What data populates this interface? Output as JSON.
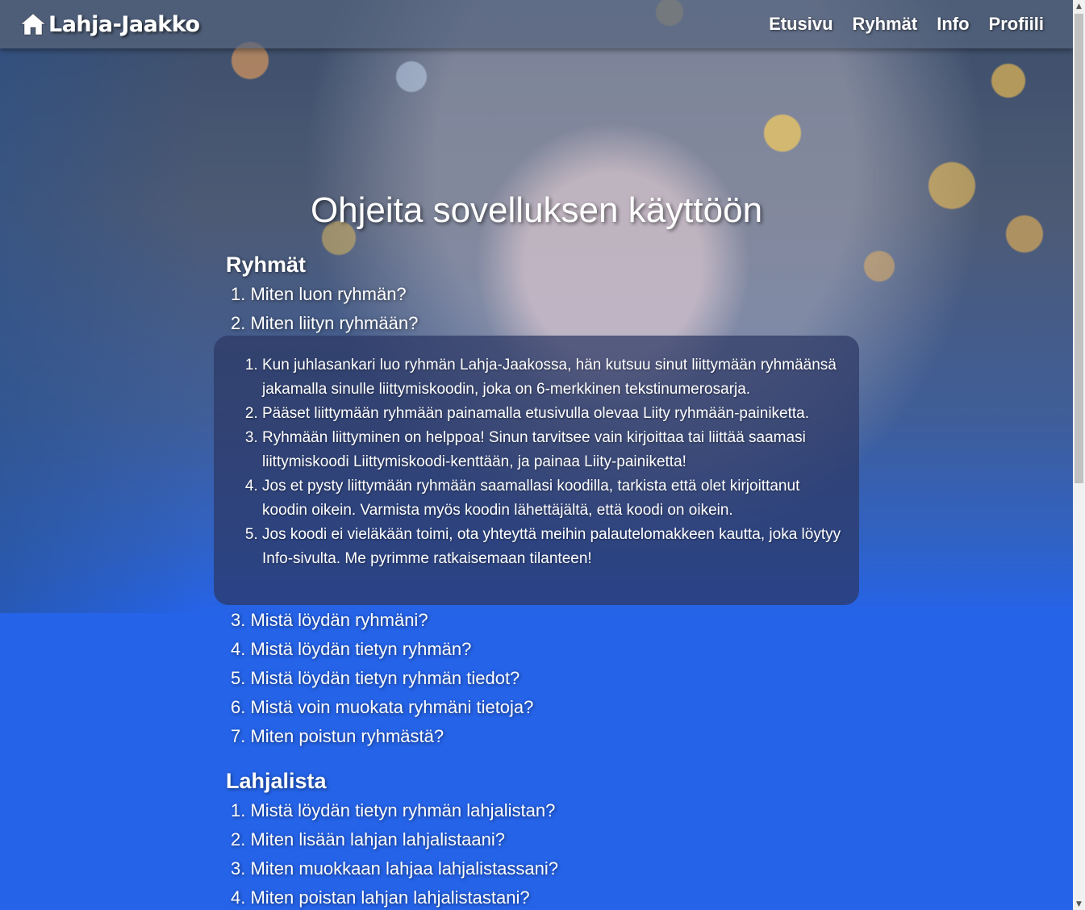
{
  "navbar": {
    "brand": "Lahja-Jaakko",
    "links": [
      "Etusivu",
      "Ryhmät",
      "Info",
      "Profiili"
    ]
  },
  "page_title": "Ohjeita sovelluksen käyttöön",
  "sections": [
    {
      "title": "Ryhmät",
      "questions": [
        "1. Miten luon ryhmän?",
        "2. Miten liityn ryhmään?",
        "3. Mistä löydän ryhmäni?",
        "4. Mistä löydän tietyn ryhmän?",
        "5. Mistä löydän tietyn ryhmän tiedot?",
        "6. Mistä voin muokata ryhmäni tietoja?",
        "7. Miten poistun ryhmästä?"
      ],
      "expanded_answer": [
        "Kun juhlasankari luo ryhmän Lahja-Jaakossa, hän kutsuu sinut liittymään ryhmäänsä jakamalla sinulle liittymiskoodin, joka on 6-merkkinen tekstinumerosarja.",
        "Pääset liittymään ryhmään painamalla etusivulla olevaa Liity ryhmään-painiketta.",
        "Ryhmään liittyminen on helppoa! Sinun tarvitsee vain kirjoittaa tai liittää saamasi liittymiskoodi Liittymiskoodi-kenttään, ja painaa Liity-painiketta!",
        "Jos et pysty liittymään ryhmään saamallasi koodilla, tarkista että olet kirjoittanut koodin oikein. Varmista myös koodin lähettäjältä, että koodi on oikein.",
        "Jos koodi ei vieläkään toimi, ota yhteyttä meihin palautelomakkeen kautta, joka löytyy Info-sivulta. Me pyrimme ratkaisemaan tilanteen!"
      ]
    },
    {
      "title": "Lahjalista",
      "questions": [
        "1. Mistä löydän tietyn ryhmän lahjalistan?",
        "2. Miten lisään lahjan lahjalistaani?",
        "3. Miten muokkaan lahjaa lahjalistassani?",
        "4. Miten poistan lahjan lahjalistastani?"
      ]
    }
  ],
  "icons": {
    "brand": "home-icon",
    "scroll_up": "scroll-up-arrow-icon",
    "scroll_down": "scroll-down-arrow-icon"
  },
  "colors": {
    "page_blue": "#2563e8",
    "answer_panel": "#2d3764"
  }
}
